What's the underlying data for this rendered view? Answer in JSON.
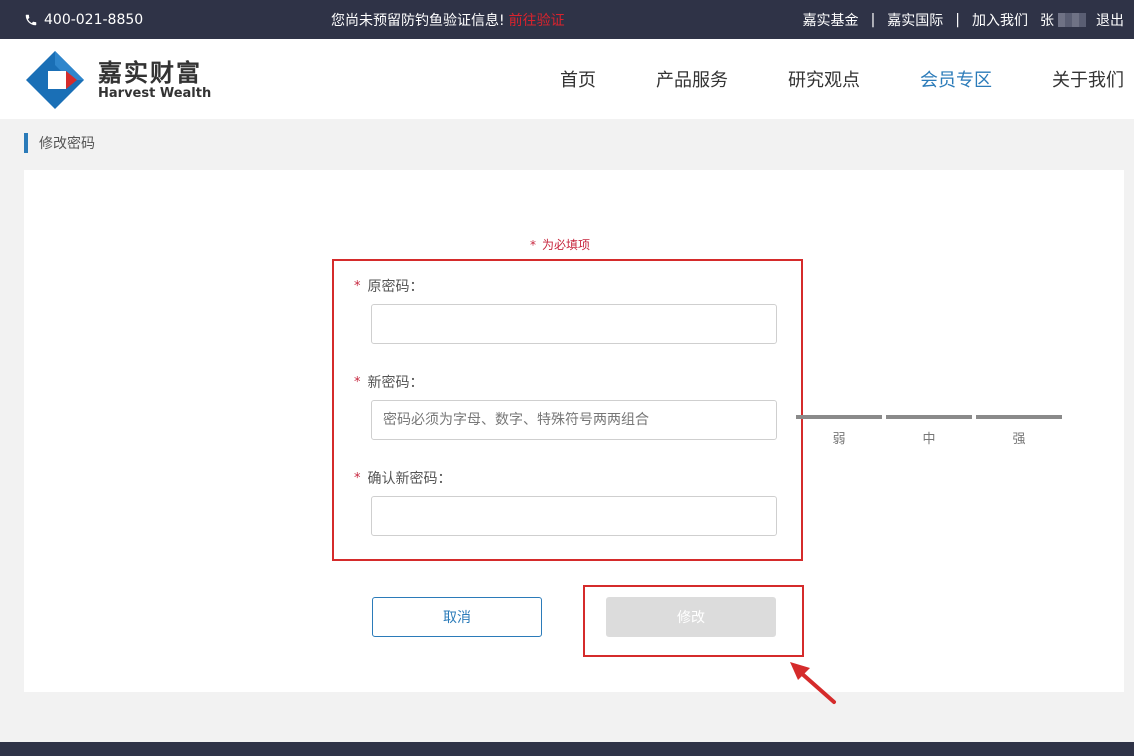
{
  "topbar": {
    "phone": "400-021-8850",
    "notice_text": "您尚未预留防钓鱼验证信息!",
    "notice_link": "前往验证",
    "links": [
      "嘉实基金",
      "嘉实国际",
      "加入我们"
    ],
    "user_name": "张",
    "logout": "退出"
  },
  "header": {
    "logo_cn": "嘉实财富",
    "logo_en": "Harvest Wealth",
    "nav": [
      "首页",
      "产品服务",
      "研究观点",
      "会员专区",
      "关于我们"
    ],
    "active_nav": "会员专区"
  },
  "page": {
    "breadcrumb": "修改密码",
    "required_note": "为必填项",
    "required_star": "*"
  },
  "form": {
    "old_password_label": "原密码：",
    "new_password_label": "新密码：",
    "new_password_placeholder": "密码必须为字母、数字、特殊符号两两组合",
    "confirm_password_label": "确认新密码：",
    "strength": [
      "弱",
      "中",
      "强"
    ],
    "cancel_label": "取消",
    "submit_label": "修改"
  },
  "colors": {
    "topbar_bg": "#2f3347",
    "accent_blue": "#2b7bb9",
    "required_red": "#c7263e",
    "highlight_red": "#d52b2b",
    "disabled_button": "#dcdcdc"
  }
}
